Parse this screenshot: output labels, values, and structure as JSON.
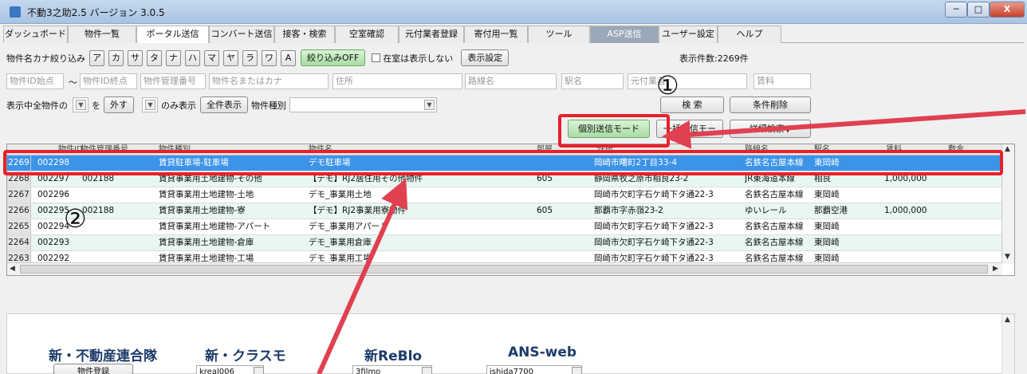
{
  "window": {
    "title": "不動3之助2.5 バージョン 3.0.5",
    "min_glyph": "─",
    "max_glyph": "□",
    "close_glyph": "X"
  },
  "tabs": [
    "ダッシュボード",
    "物件一覧",
    "ポータル送信",
    "コンバート送信",
    "接客・検索",
    "空室確認",
    "元付業者登録",
    "寄付用一覧",
    "ツール",
    "ASP送信",
    "ユーザー設定",
    "ヘルプ"
  ],
  "kana_filter": {
    "label": "物件名カナ絞り込み",
    "keys": [
      "ア",
      "カ",
      "サ",
      "タ",
      "ナ",
      "ハ",
      "マ",
      "ヤ",
      "ラ",
      "ワ",
      "A"
    ],
    "off_button": "絞り込みOFF",
    "vacant_checkbox": "在室は表示しない",
    "display_settings": "表示設定",
    "count": "表示件数:2269件"
  },
  "search_fields": {
    "id_start": "物件ID始点",
    "tilde": "〜",
    "id_end": "物件ID終点",
    "mgmt_no": "物件管理番号",
    "name": "物件名またはカナ",
    "address": "住所",
    "line": "路線名",
    "station": "駅名",
    "agent": "元付業者",
    "rent": "賃料"
  },
  "show_row": {
    "label": "表示中全物件の",
    "wo": "を",
    "remove_button": "外す",
    "only_show": "のみ表示",
    "all_show_button": "全件表示",
    "type_label": "物件種別",
    "search_button": "検 索",
    "clear_button": "条件削除"
  },
  "mode_row": {
    "individual_send": "個別送信モード",
    "bulk_send": "一括送信モード",
    "detail_search": "詳細検索▼"
  },
  "grid": {
    "headers": [
      "物件ID",
      "物件管理番号",
      "物件種別",
      "物件名",
      "部屋",
      "住所",
      "路線名",
      "駅名",
      "賃料",
      "敷金"
    ],
    "rows": [
      {
        "rn": "2269",
        "id": "002298",
        "mgmt": "",
        "type": "賃貸駐車場-駐車場",
        "name": "デモ駐車場",
        "room": "",
        "addr": "岡崎市曙町2丁目33-4",
        "line": "名鉄名古屋本線",
        "station": "東岡崎",
        "rent": ""
      },
      {
        "rn": "2268",
        "id": "002297",
        "mgmt": "002188",
        "type": "賃貸事業用土地建物-その他",
        "name": "【デモ】RJ2居住用その他物件",
        "room": "605",
        "addr": "静岡県牧之原市相良23-2",
        "line": "JR東海道本線",
        "station": "相良",
        "rent": "1,000,000"
      },
      {
        "rn": "2267",
        "id": "002296",
        "mgmt": "",
        "type": "賃貸事業用土地建物-土地",
        "name": "デモ_事業用土地",
        "room": "",
        "addr": "岡崎市欠町字石ケ崎下タ通22-3",
        "line": "名鉄名古屋本線",
        "station": "東岡崎",
        "rent": ""
      },
      {
        "rn": "2266",
        "id": "002295",
        "mgmt": "002188",
        "type": "賃貸事業用土地建物-寮",
        "name": "【デモ】RJ2事業用寮物件",
        "room": "605",
        "addr": "那覇市字赤嶺23-2",
        "line": "ゆいレール",
        "station": "那覇空港",
        "rent": "1,000,000"
      },
      {
        "rn": "2265",
        "id": "002294",
        "mgmt": "",
        "type": "賃貸事業用土地建物-アパート",
        "name": "デモ_事業用アパート",
        "room": "",
        "addr": "岡崎市欠町字石ケ崎下タ通22-3",
        "line": "名鉄名古屋本線",
        "station": "東岡崎",
        "rent": ""
      },
      {
        "rn": "2264",
        "id": "002293",
        "mgmt": "",
        "type": "賃貸事業用土地建物-倉庫",
        "name": "デモ_事業用倉庫",
        "room": "",
        "addr": "岡崎市欠町字石ケ崎下タ通22-3",
        "line": "名鉄名古屋本線",
        "station": "東岡崎",
        "rent": ""
      },
      {
        "rn": "2263",
        "id": "002292",
        "mgmt": "",
        "type": "賃貸事業用土地建物-工場",
        "name": "デモ_事業用工場",
        "room": "",
        "addr": "岡崎市欠町字石ケ崎下タ通22-3",
        "line": "名鉄名古屋本線",
        "station": "東岡崎",
        "rent": ""
      }
    ]
  },
  "portals": {
    "p1": {
      "name": "新・不動産連合隊",
      "button": "物件登録"
    },
    "p2": {
      "name": "新・クラスモ",
      "value": "kreal006"
    },
    "p3": {
      "name": "新ReBlo",
      "value": "3filmo"
    },
    "p4": {
      "name": "ANS-web",
      "value": "ishida7700"
    }
  },
  "annotations": {
    "one": "①",
    "two": "②"
  },
  "colors": {
    "selected_row": "#3c93e8",
    "alt_row": "#e8f7f0",
    "annotation_red": "#e8202a"
  }
}
